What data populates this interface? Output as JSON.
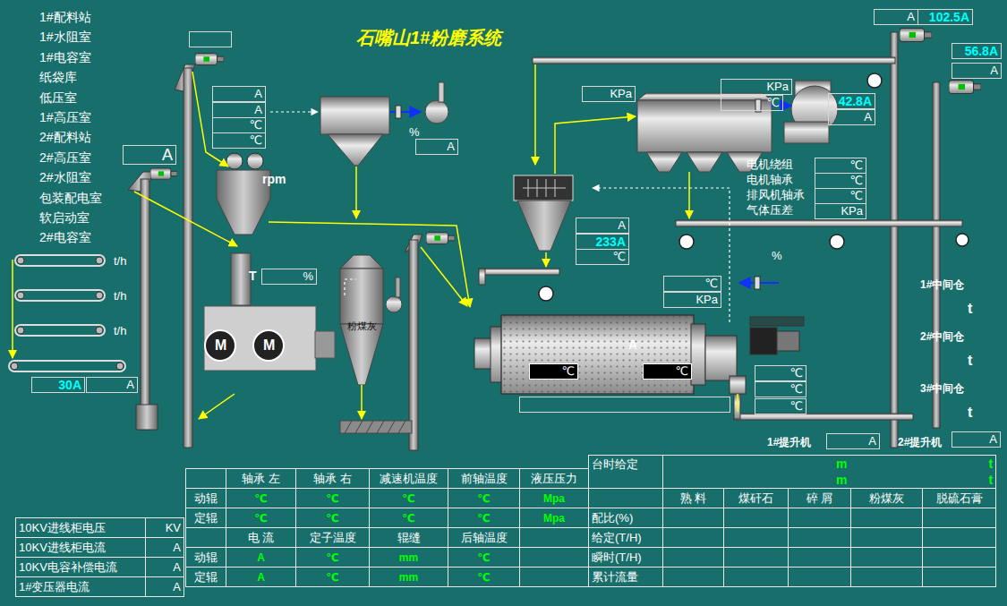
{
  "window": {
    "title": "石嘴山1#粉磨系统"
  },
  "rooms": [
    "1#配料站",
    "1#水阻室",
    "1#电容室",
    "纸袋库",
    "低压室",
    "1#高压室",
    "2#配料站",
    "2#高压室",
    "2#水阻室",
    "包装配电室",
    "软启动室",
    "2#电容室"
  ],
  "readouts": {
    "main_elevator_unit": {
      "text": "A",
      "live": false
    },
    "main_elevator_current": {
      "text": "102.5A",
      "live": true
    },
    "right_elevator_current": {
      "text": "56.8A",
      "live": true
    },
    "right_elevator_unit": {
      "text": "A",
      "live": false
    },
    "press_current_1": {
      "text": "A",
      "live": false
    },
    "press_current_2": {
      "text": "A",
      "live": false
    },
    "press_temp_1": {
      "text": "℃",
      "live": false
    },
    "press_temp_2": {
      "text": "℃",
      "live": false
    },
    "feed_elevator_current": {
      "text": "A",
      "live": false
    },
    "bag_fan_current": {
      "text": "A",
      "live": false
    },
    "press_level": {
      "text": "%",
      "live": false
    },
    "collector_pressure": {
      "text": "KPa",
      "live": false
    },
    "fan_inlet_pressure": {
      "text": "KPa",
      "live": false
    },
    "fan_inlet_temp": {
      "text": "℃",
      "live": false
    },
    "main_fan_current": {
      "text": "42.8A",
      "live": true
    },
    "main_fan_unit": {
      "text": "A",
      "live": false
    },
    "separator_unit": {
      "text": "A",
      "live": false
    },
    "separator_current": {
      "text": "233A",
      "live": true
    },
    "separator_temp": {
      "text": "℃",
      "live": false
    },
    "mill_inlet_temp": {
      "text": "℃",
      "live": false
    },
    "mill_inlet_pressure": {
      "text": "KPa",
      "live": false
    },
    "mill_temp_left": {
      "text": "℃",
      "live": false
    },
    "mill_temp_right": {
      "text": "℃",
      "live": false
    },
    "mill_outlet_temp_1": {
      "text": "℃",
      "live": false
    },
    "mill_outlet_temp_2": {
      "text": "℃",
      "live": false
    },
    "mill_outlet_temp_3": {
      "text": "℃",
      "live": false
    },
    "belt_current": {
      "text": "30A",
      "live": true
    },
    "belt_unit": {
      "text": "A",
      "live": false
    }
  },
  "labels": {
    "rpm": "rpm",
    "press_tag": "T",
    "bag_damper": "%",
    "mill_damper": "%",
    "mill_current": "A",
    "fly_ash_silo": "粉煤灰"
  },
  "press_motors": [
    "M",
    "M"
  ],
  "feeders": [
    {
      "unit": "t/h"
    },
    {
      "unit": "t/h"
    },
    {
      "unit": "t/h"
    }
  ],
  "fan_sensors": [
    {
      "label": "电机绕组",
      "unit": "℃"
    },
    {
      "label": "电机轴承",
      "unit": "℃"
    },
    {
      "label": "排风机轴承",
      "unit": "℃"
    },
    {
      "label": "气体压差",
      "unit": "KPa"
    }
  ],
  "bins": [
    {
      "name": "1#中间仓",
      "unit": "t"
    },
    {
      "name": "2#中间仓",
      "unit": "t"
    },
    {
      "name": "3#中间仓",
      "unit": "t"
    }
  ],
  "elevators": [
    {
      "name": "1#提升机",
      "unit": "A"
    },
    {
      "name": "2#提升机",
      "unit": "A"
    }
  ],
  "press_table": {
    "header_top": [
      "轴承 左",
      "轴承 右",
      "减速机温度",
      "前轴温度",
      "液压压力"
    ],
    "top_rows": [
      {
        "label": "动辊",
        "cells": [
          "℃",
          "℃",
          "℃",
          "℃",
          "Mpa"
        ]
      },
      {
        "label": "定辊",
        "cells": [
          "℃",
          "℃",
          "℃",
          "℃",
          "Mpa"
        ]
      }
    ],
    "header_bottom": [
      "电 流",
      "定子温度",
      "辊缝",
      "后轴温度"
    ],
    "bottom_rows": [
      {
        "label": "动辊",
        "cells": [
          "A",
          "℃",
          "mm",
          "℃"
        ]
      },
      {
        "label": "定辊",
        "cells": [
          "A",
          "℃",
          "mm",
          "℃"
        ]
      }
    ]
  },
  "feed_table": {
    "title": "台时给定",
    "setpoints": [
      {
        "value": "m",
        "unit": "t"
      },
      {
        "value": "m",
        "unit": "t"
      }
    ],
    "columns": [
      "熟 料",
      "煤矸石",
      "碎 屑",
      "粉煤灰",
      "脱硫石膏"
    ],
    "rows": [
      "配比(%)",
      "给定(T/H)",
      "瞬时(T/H)",
      "累计流量"
    ]
  },
  "power_table": [
    {
      "label": "10KV进线柜电压",
      "unit": "KV"
    },
    {
      "label": "10KV进线柜电流",
      "unit": "A"
    },
    {
      "label": "10KV电容补偿电流",
      "unit": "A"
    },
    {
      "label": "1#变压器电流",
      "unit": "A"
    }
  ]
}
